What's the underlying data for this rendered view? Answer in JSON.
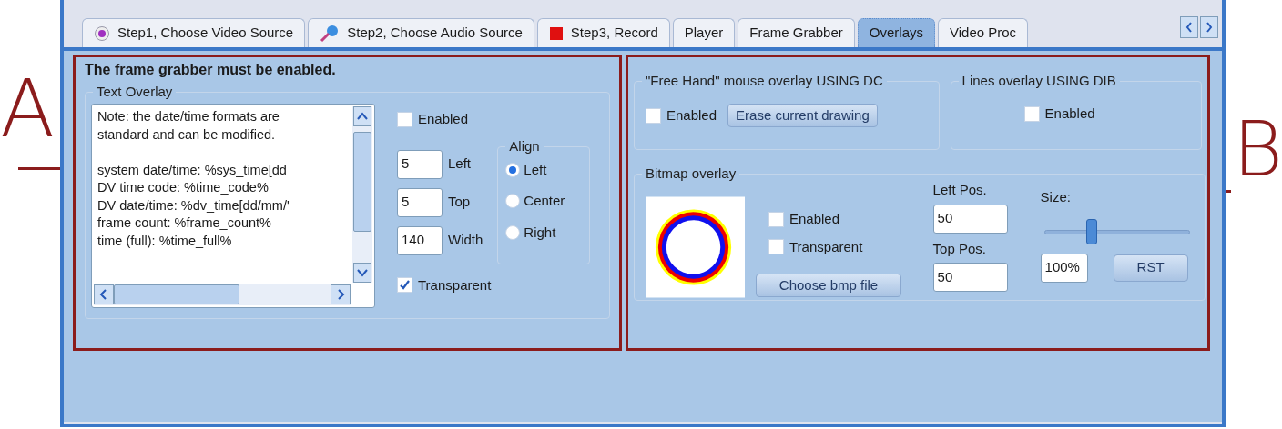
{
  "annotations": [
    {
      "label": "A"
    },
    {
      "label": "B"
    }
  ],
  "tabs": [
    {
      "label": "Step1, Choose Video Source",
      "kind": "video",
      "selected": false
    },
    {
      "label": "Step2, Choose Audio Source",
      "kind": "audio",
      "selected": false
    },
    {
      "label": "Step3, Record",
      "kind": "record",
      "selected": false
    },
    {
      "label": "Player",
      "kind": "plain",
      "selected": false
    },
    {
      "label": "Frame Grabber",
      "kind": "plain",
      "selected": false
    },
    {
      "label": "Overlays",
      "kind": "plain",
      "selected": true
    },
    {
      "label": "Video Proc",
      "kind": "plain",
      "selected": false
    }
  ],
  "warning": "The frame grabber must be enabled.",
  "text_overlay": {
    "title": "Text Overlay",
    "paragraphs": [
      [
        "Note: the date/time formats are",
        "standard and can be modified."
      ],
      [
        "system date/time: %sys_time[dd",
        "DV time code: %time_code%",
        "DV date/time: %dv_time[dd/mm/'",
        "frame count: %frame_count%",
        "time (full): %time_full%"
      ]
    ],
    "enabled": {
      "label": "Enabled",
      "checked": false
    },
    "fields": [
      {
        "value": "5",
        "label": "Left"
      },
      {
        "value": "5",
        "label": "Top"
      },
      {
        "value": "140",
        "label": "Width"
      }
    ],
    "align": {
      "title": "Align",
      "options": [
        {
          "label": "Left",
          "selected": true
        },
        {
          "label": "Center",
          "selected": false
        },
        {
          "label": "Right",
          "selected": false
        }
      ]
    },
    "transparent": {
      "label": "Transparent",
      "checked": true
    }
  },
  "free_hand": {
    "title": "\"Free Hand\" mouse overlay USING DC",
    "enabled": {
      "label": "Enabled",
      "checked": false
    },
    "button": "Erase current drawing"
  },
  "lines_overlay": {
    "title": "Lines overlay USING DIB",
    "enabled": {
      "label": "Enabled",
      "checked": false
    }
  },
  "bitmap": {
    "title": "Bitmap overlay",
    "enabled": {
      "label": "Enabled",
      "checked": false
    },
    "transparent": {
      "label": "Transparent",
      "checked": false
    },
    "button": "Choose bmp file",
    "left_pos": {
      "label": "Left Pos.",
      "value": "50"
    },
    "top_pos": {
      "label": "Top Pos.",
      "value": "50"
    },
    "size": {
      "label": "Size:",
      "level": 0.33,
      "value": "100%"
    },
    "reset_button": "RST"
  }
}
